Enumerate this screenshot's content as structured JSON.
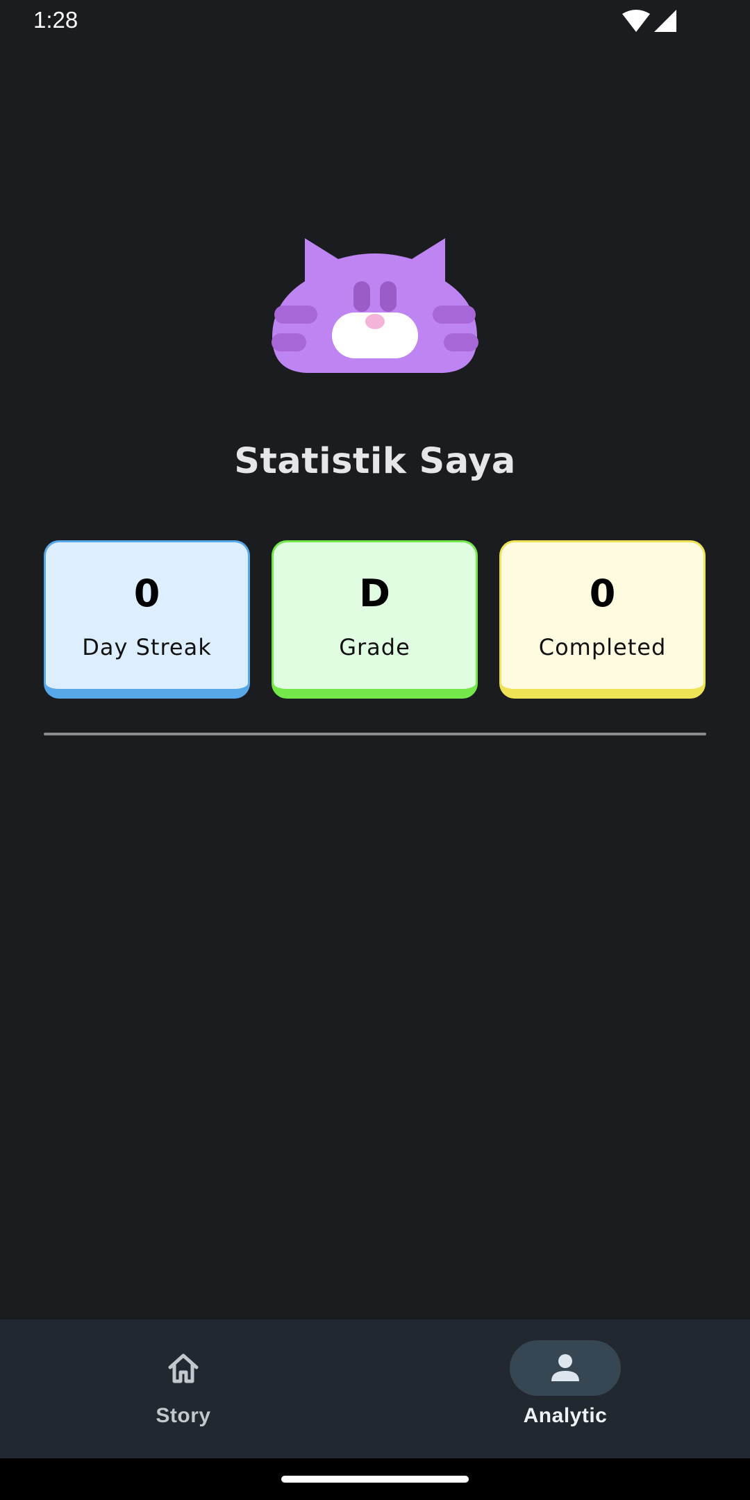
{
  "status_bar": {
    "time": "1:28"
  },
  "header": {
    "title": "Statistik Saya"
  },
  "stats": [
    {
      "value": "0",
      "label": "Day Streak",
      "bg": "#ddeeff",
      "border": "#57a8e8"
    },
    {
      "value": "D",
      "label": "Grade",
      "bg": "#e1fde1",
      "border": "#74e84b"
    },
    {
      "value": "0",
      "label": "Completed",
      "bg": "#fffbe0",
      "border": "#eee354"
    }
  ],
  "nav": {
    "items": [
      {
        "label": "Story",
        "icon": "home-icon",
        "active": false
      },
      {
        "label": "Analytic",
        "icon": "person-icon",
        "active": true
      }
    ]
  },
  "colors": {
    "background": "#1a1c1f",
    "nav_background": "#22282f",
    "active_pill": "#364653",
    "mascot": "#be84f2"
  }
}
